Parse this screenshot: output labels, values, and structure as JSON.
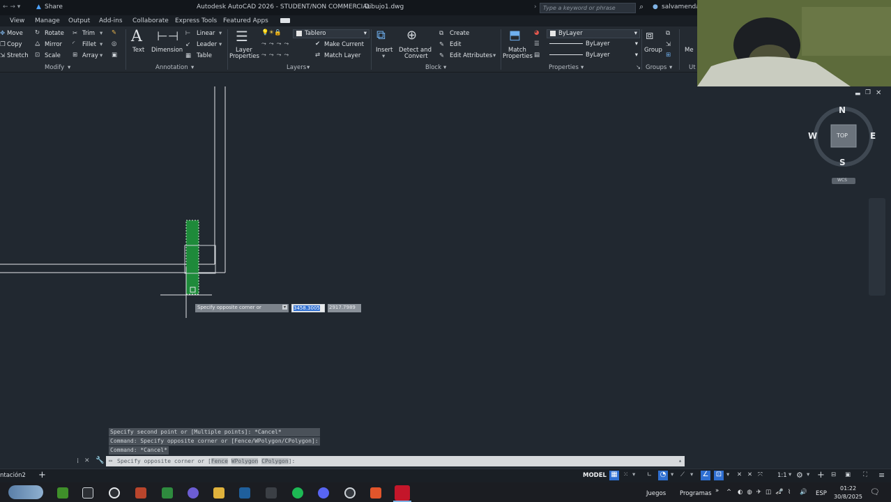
{
  "titlebar": {
    "share_label": "Share",
    "title": "Autodesk AutoCAD 2026 - STUDENT/NON COMMERCIAL",
    "filename": "Dibujo1.dwg",
    "search_placeholder": "Type a keyword or phrase",
    "user": "salvamenda"
  },
  "menu": [
    "View",
    "Manage",
    "Output",
    "Add-ins",
    "Collaborate",
    "Express Tools",
    "Featured Apps"
  ],
  "ribbon": {
    "modify": {
      "move": "Move",
      "rotate": "Rotate",
      "trim": "Trim",
      "copy": "Copy",
      "mirror": "Mirror",
      "fillet": "Fillet",
      "stretch": "Stretch",
      "scale": "Scale",
      "array": "Array",
      "label": "Modify"
    },
    "annotation": {
      "text": "Text",
      "dimension": "Dimension",
      "linear": "Linear",
      "leader": "Leader",
      "table": "Table",
      "label": "Annotation"
    },
    "layers": {
      "layer_properties_1": "Layer",
      "layer_properties_2": "Properties",
      "current_layer": "Tablero",
      "make_current": "Make Current",
      "match_layer": "Match Layer",
      "label": "Layers"
    },
    "block": {
      "insert": "Insert",
      "detect_1": "Detect and",
      "detect_2": "Convert",
      "create": "Create",
      "edit": "Edit",
      "edit_attributes": "Edit Attributes",
      "label": "Block"
    },
    "properties": {
      "match_1": "Match",
      "match_2": "Properties",
      "color": "ByLayer",
      "linetype": "ByLayer",
      "lineweight": "ByLayer",
      "label": "Properties"
    },
    "groups": {
      "group": "Group",
      "label": "Groups",
      "more": "Me",
      "ut": "Ut"
    }
  },
  "viewcube": {
    "north": "N",
    "south": "S",
    "east": "E",
    "west": "W",
    "face": "TOP",
    "wcs": "WCS"
  },
  "tooltip": {
    "prompt": "Specify opposite corner or",
    "x_value": "3458.3005",
    "y_value": "2917.7989"
  },
  "command_history": [
    "Specify second point or [Multiple points]: *Cancel*",
    "Command: Specify opposite corner or [Fence/WPolygon/CPolygon]:",
    "Command: *Cancel*"
  ],
  "command_line": {
    "prefix": "Specify opposite corner or [",
    "opt1": "Fence",
    "opt2": "WPolygon",
    "opt3": "CPolygon",
    "suffix": "]:"
  },
  "status": {
    "layout_tab": "ntación2",
    "model": "MODEL",
    "scale": "1:1"
  },
  "taskbar": {
    "juegos": "Juegos",
    "programas": "Programas",
    "lang": "ESP",
    "time": "01:22",
    "date": "30/8/2025"
  },
  "colors": {
    "accent": "#1e8a3a",
    "canvas": "#212830",
    "ribbon": "#242a31"
  }
}
